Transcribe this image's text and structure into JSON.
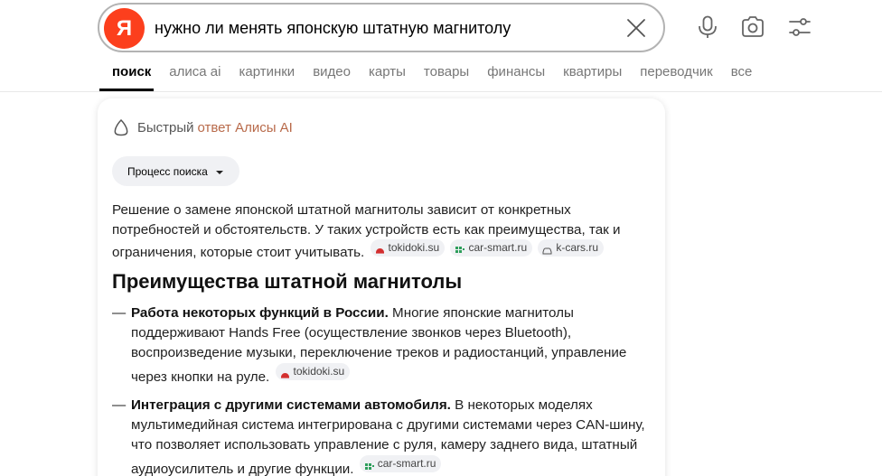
{
  "search": {
    "logo_letter": "Я",
    "query": "нужно ли менять японскую штатную магнитолу"
  },
  "tabs": [
    {
      "label": "поиск",
      "active": true
    },
    {
      "label": "алиса ai"
    },
    {
      "label": "картинки"
    },
    {
      "label": "видео"
    },
    {
      "label": "карты"
    },
    {
      "label": "товары"
    },
    {
      "label": "финансы"
    },
    {
      "label": "квартиры"
    },
    {
      "label": "переводчик"
    },
    {
      "label": "все"
    }
  ],
  "icons": {
    "clear": "close-icon",
    "voice": "microphone-icon",
    "camera": "camera-search-icon",
    "settings": "filter-settings-icon"
  },
  "alice": {
    "label_part1": "Быстрый",
    "label_part2": "ответ Алисы AI",
    "process_button": "Процесс поиска"
  },
  "answer": {
    "intro": "Решение о замене японской штатной магнитолы зависит от конкретных потребностей и обстоятельств. У таких устройств есть как преимущества, так и ограничения, которые стоит учитывать.",
    "intro_sources": [
      "tokidoki.su",
      "car-smart.ru",
      "k-cars.ru"
    ],
    "heading": "Преимущества штатной магнитолы",
    "items": [
      {
        "bold": "Работа некоторых функций в России.",
        "text": " Многие японские магнитолы поддерживают Hands Free (осуществление звонков через Bluetooth), воспроизведение музыки, переключение треков и радиостанций, управление через кнопки на руле.",
        "source": "tokidoki.su"
      },
      {
        "bold": "Интеграция с другими системами автомобиля.",
        "text": " В некоторых моделях мультимедийная система интегрирована с другими системами через CAN-шину, что позволяет использовать управление с руля, камеру заднего вида, штатный аудиоусилитель и другие функции.",
        "source": "car-smart.ru"
      }
    ]
  },
  "colors": {
    "brand": "#fc3f1d",
    "alice_accent": "#b86a4a",
    "chip_bg": "#f0f1f4"
  }
}
